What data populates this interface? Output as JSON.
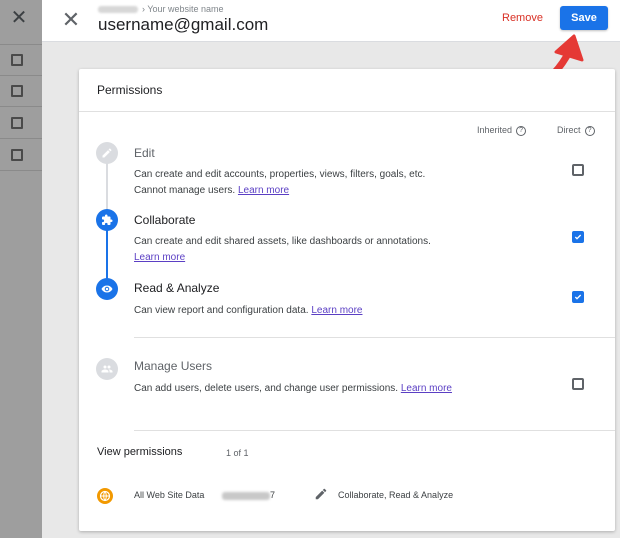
{
  "header": {
    "breadcrumb_separator": "›",
    "breadcrumb_page": "Your website name",
    "user_title": "username@gmail.com",
    "remove_label": "Remove",
    "save_label": "Save"
  },
  "permissions": {
    "title": "Permissions",
    "col_inherited": "Inherited",
    "col_direct": "Direct",
    "help_glyph": "?",
    "items": [
      {
        "title": "Edit",
        "desc": "Can create and edit accounts, properties, views, filters, goals, etc. Cannot manage users.",
        "link": "Learn more",
        "direct_checked": false,
        "icon": "pencil-icon",
        "active": false
      },
      {
        "title": "Collaborate",
        "desc": "Can create and edit shared assets, like dashboards or annotations.",
        "link": "Learn more",
        "direct_checked": true,
        "icon": "puzzle-icon",
        "active": true
      },
      {
        "title": "Read & Analyze",
        "desc": "Can view report and configuration data.",
        "link": "Learn more",
        "direct_checked": true,
        "icon": "eye-icon",
        "active": true
      },
      {
        "title": "Manage Users",
        "desc": "Can add users, delete users, and change user permissions.",
        "link": "Learn more",
        "direct_checked": false,
        "icon": "people-icon",
        "active": false
      }
    ]
  },
  "view_permissions": {
    "label": "View permissions",
    "count": "1 of 1",
    "site_name": "All Web Site Data",
    "site_id_suffix": "7",
    "site_permissions": "Collaborate, Read & Analyze"
  },
  "colors": {
    "accent": "#1a73e8",
    "remove": "#d93025",
    "annotation_arrow": "#e53935",
    "site_icon": "#f29900"
  }
}
